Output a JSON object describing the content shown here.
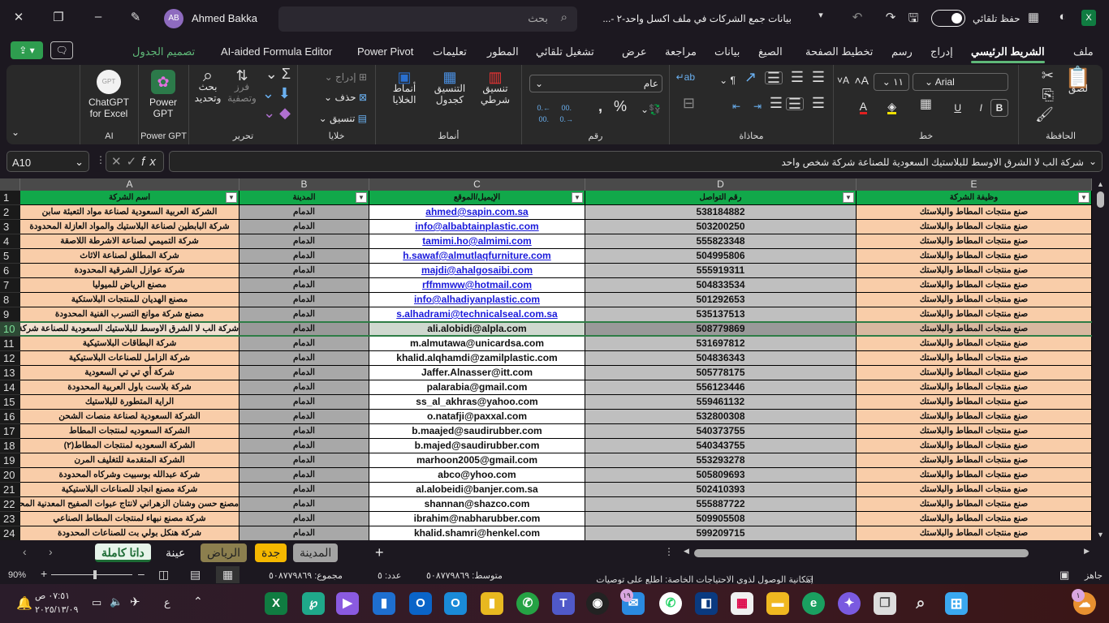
{
  "titlebar": {
    "app_icon": "excel-icon",
    "autosave_label": "حفظ تلقائي",
    "title": "بيانات جمع الشركات في ملف اكسل واحد-٢ -...",
    "search_placeholder": "بحث",
    "user_initials": "AB",
    "user_name": "Ahmed Bakka"
  },
  "tabs": {
    "items": [
      "ملف",
      "الشريط الرئيسي",
      "إدراج",
      "رسم",
      "تخطيط الصفحة",
      "الصيغ",
      "بيانات",
      "مراجعة",
      "عرض",
      "تشغيل تلقائي",
      "المطور",
      "تعليمات",
      "Power Pivot",
      "AI-aided Formula Editor",
      "تصميم الجدول"
    ],
    "active": "الشريط الرئيسي"
  },
  "ribbon": {
    "clipboard": {
      "label": "الحافظة",
      "paste": "لصق"
    },
    "font": {
      "label": "خط",
      "name": "Arial",
      "size": "١١",
      "bold": "B",
      "italic": "I",
      "underline": "U"
    },
    "alignment": {
      "label": "محاذاة"
    },
    "number": {
      "label": "رقم",
      "format": "عام"
    },
    "styles": {
      "label": "أنماط",
      "conditional": "تنسيق شرطي",
      "table": "التنسيق كجدول",
      "cell": "أنماط الخلايا"
    },
    "cells": {
      "label": "خلايا",
      "insert": "إدراج",
      "delete": "حذف",
      "format": "تنسيق"
    },
    "editing": {
      "label": "تحرير",
      "sort": "فرز وتصفية",
      "find": "بحث وتحديد"
    },
    "powergpt": {
      "label": "Power GPT",
      "button": "Power GPT"
    },
    "ai": {
      "label": "AI",
      "button": "ChatGPT for Excel"
    }
  },
  "formula_bar": {
    "name_box": "A10",
    "formula": "شركة الب لا الشرق الاوسط للبلاستيك السعودية للصناعة شركة شخص واحد"
  },
  "sheet": {
    "columns": [
      "A",
      "B",
      "C",
      "D",
      "E"
    ],
    "headers": [
      "اسم الشركة",
      "المدينة",
      "الإيميل/الموقع",
      "رقم التواصل",
      "وظيفة الشركة"
    ],
    "selected_row": 10,
    "colors": {
      "header": "#11a84a",
      "col_a": "#f9cda9",
      "col_b": "#a8a8a8",
      "col_c": "#ffffff",
      "col_d": "#bfbfbf",
      "col_e": "#f9cda9"
    },
    "rows": [
      [
        "الشركة العربية السعودية لصناعة مواد التعبئة سابن",
        "الدمام",
        "ahmed@sapin.com.sa",
        "538184882",
        "صنع منتجات المطاط والبلاستك"
      ],
      [
        "شركة البابطين لصناعة البلاستيك والمواد العازلة المحدودة",
        "الدمام",
        "info@albabtainplastic.com",
        "503200250",
        "صنع منتجات المطاط والبلاستك"
      ],
      [
        "شركة التميمي لصناعة الاشرطة اللاصقة",
        "الدمام",
        "tamimi.ho@almimi.com",
        "555823348",
        "صنع منتجات المطاط والبلاستك"
      ],
      [
        "شركة المطلق لصناعة الاثاث",
        "الدمام",
        "h.sawaf@almutlaqfurniture.com",
        "504995806",
        "صنع منتجات المطاط والبلاستك"
      ],
      [
        "شركة عوازل الشرقية المحدودة",
        "الدمام",
        "majdi@ahalgosaibi.com",
        "555919311",
        "صنع منتجات المطاط والبلاستك"
      ],
      [
        "مصنع الرياض للميوليا",
        "الدمام",
        "rffmmww@hotmail.com",
        "504833534",
        "صنع منتجات المطاط والبلاستك"
      ],
      [
        "مصنع الهديان للمنتجات البلاستكية",
        "الدمام",
        "info@alhadiyanplastic.com",
        "501292653",
        "صنع منتجات المطاط والبلاستك"
      ],
      [
        "مصنع شركة موانع التسرب الفنية المحدودة",
        "الدمام",
        "s.alhadrami@technicalseal.com.sa",
        "535137513",
        "صنع منتجات المطاط والبلاستك"
      ],
      [
        "شركة الب لا الشرق الاوسط للبلاستيك السعودية للصناعة شركة شخص واحد",
        "الدمام",
        "ali.alobidi@alpla.com",
        "508779869",
        "صنع منتجات المطاط والبلاستك"
      ],
      [
        "شركة البطاقات البلاستيكية",
        "الدمام",
        "m.almutawa@unicardsa.com",
        "531697812",
        "صنع منتجات المطاط والبلاستك"
      ],
      [
        "شركة الزامل للصناعات البلاستيكية",
        "الدمام",
        "khalid.alqhamdi@zamilplastic.com",
        "504836343",
        "صنع منتجات المطاط والبلاستك"
      ],
      [
        "شركة أي تي تي السعودية",
        "الدمام",
        "Jaffer.Alnasser@itt.com",
        "505778175",
        "صنع منتجات المطاط والبلاستك"
      ],
      [
        "شركة بلاست باول العربية المحدودة",
        "الدمام",
        "palarabia@gmail.com",
        "556123446",
        "صنع منتجات المطاط والبلاستك"
      ],
      [
        "الراية المتطورة للبلاستيك",
        "الدمام",
        "ss_al_akhras@yahoo.com",
        "559461132",
        "صنع منتجات المطاط والبلاستك"
      ],
      [
        "الشركة السعودية لصناعة منصات الشحن",
        "الدمام",
        "o.natafji@paxxal.com",
        "532800308",
        "صنع منتجات المطاط والبلاستك"
      ],
      [
        "الشركة السعوديه لمنتجات المطاط",
        "الدمام",
        "b.maajed@saudirubber.com",
        "540373755",
        "صنع منتجات المطاط والبلاستك"
      ],
      [
        "الشركة السعوديه لمنتجات المطاط(٢)",
        "الدمام",
        "b.majed@saudirubber.com",
        "540343755",
        "صنع منتجات المطاط والبلاستك"
      ],
      [
        "الشركة المتقدمة للتغليف المرن",
        "الدمام",
        "marhoon2005@gmail.com",
        "553293278",
        "صنع منتجات المطاط والبلاستك"
      ],
      [
        "شركة عبدالله بوسبيت وشركاه المحدودة",
        "الدمام",
        "abco@yhoo.com",
        "505809693",
        "صنع منتجات المطاط والبلاستك"
      ],
      [
        "شركة مصنع انجاد للصناعات البلاستيكية",
        "الدمام",
        "al.alobeidi@banjer.com.sa",
        "502410393",
        "صنع منتجات المطاط والبلاستك"
      ],
      [
        "مصنع حسن وشنان الزهراني لانتاج عبوات الصفيح المعدنية المحدودة",
        "الدمام",
        "shannan@shazco.com",
        "555887722",
        "صنع منتجات المطاط والبلاستك"
      ],
      [
        "شركة مصنع نبهاء لمنتجات المطاط الصناعي",
        "الدمام",
        "ibrahim@nabharubber.com",
        "509905508",
        "صنع منتجات المطاط والبلاستك"
      ],
      [
        "شركة هنكل بولي بت للصناعات المحدودة",
        "الدمام",
        "khalid.shamri@henkel.com",
        "599209715",
        "صنع منتجات المطاط والبلاستك"
      ]
    ],
    "hyperlink_rows": 8
  },
  "sheet_tabs": {
    "items": [
      {
        "label": "داتا كاملة",
        "color": "#e6f4ea"
      },
      {
        "label": "عينة",
        "color": ""
      },
      {
        "label": "الرياض",
        "color": "#8c7f4e"
      },
      {
        "label": "جدة",
        "color": "#f5b800"
      },
      {
        "label": "المدينة",
        "color": "#a3a3a3"
      }
    ],
    "active": "داتا كاملة",
    "add": "+"
  },
  "status": {
    "ready": "جاهز",
    "accessibility": "إمكانية الوصول لذوي الاحتياجات الخاصة: اطلع على توصيات",
    "average": "متوسط: ٥٠٨٧٧٩٨٦٩",
    "count": "عدد: ٥",
    "sum": "مجموع: ٥٠٨٧٧٩٨٦٩",
    "zoom": "90%",
    "zoom_level": 90
  },
  "taskbar": {
    "time": "٠٧:٥١ ص",
    "date": "٢٠٢٥/١٣/٠٩",
    "lang": "ع",
    "mail_badge": "١٩",
    "weather_badge": "١"
  }
}
